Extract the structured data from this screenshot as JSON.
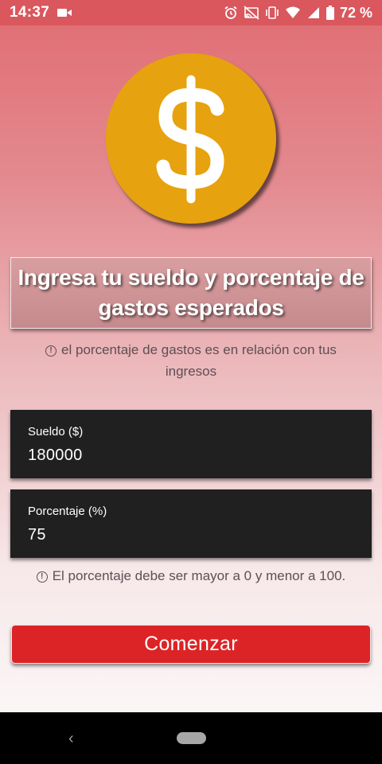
{
  "status_bar": {
    "time": "14:37",
    "battery": "72 %",
    "icons": [
      "video-icon",
      "alarm-icon",
      "cast-off-icon",
      "vibrate-icon",
      "wifi-icon",
      "signal-icon",
      "battery-icon"
    ]
  },
  "coin": {
    "symbol": "$",
    "icon": "dollar-coin-icon",
    "color": "#e6a20f"
  },
  "title": "Ingresa tu sueldo y porcentaje de gastos esperados",
  "hint_top": "el porcentaje de gastos es en relación con tus ingresos",
  "fields": {
    "sueldo": {
      "label": "Sueldo ($)",
      "value": "180000"
    },
    "porcentaje": {
      "label": "Porcentaje (%)",
      "value": "75"
    }
  },
  "hint_bottom": "El porcentaje debe ser mayor a 0 y menor a 100.",
  "start_button": "Comenzar",
  "colors": {
    "accent": "#dc2426",
    "field_bg": "#202020"
  }
}
